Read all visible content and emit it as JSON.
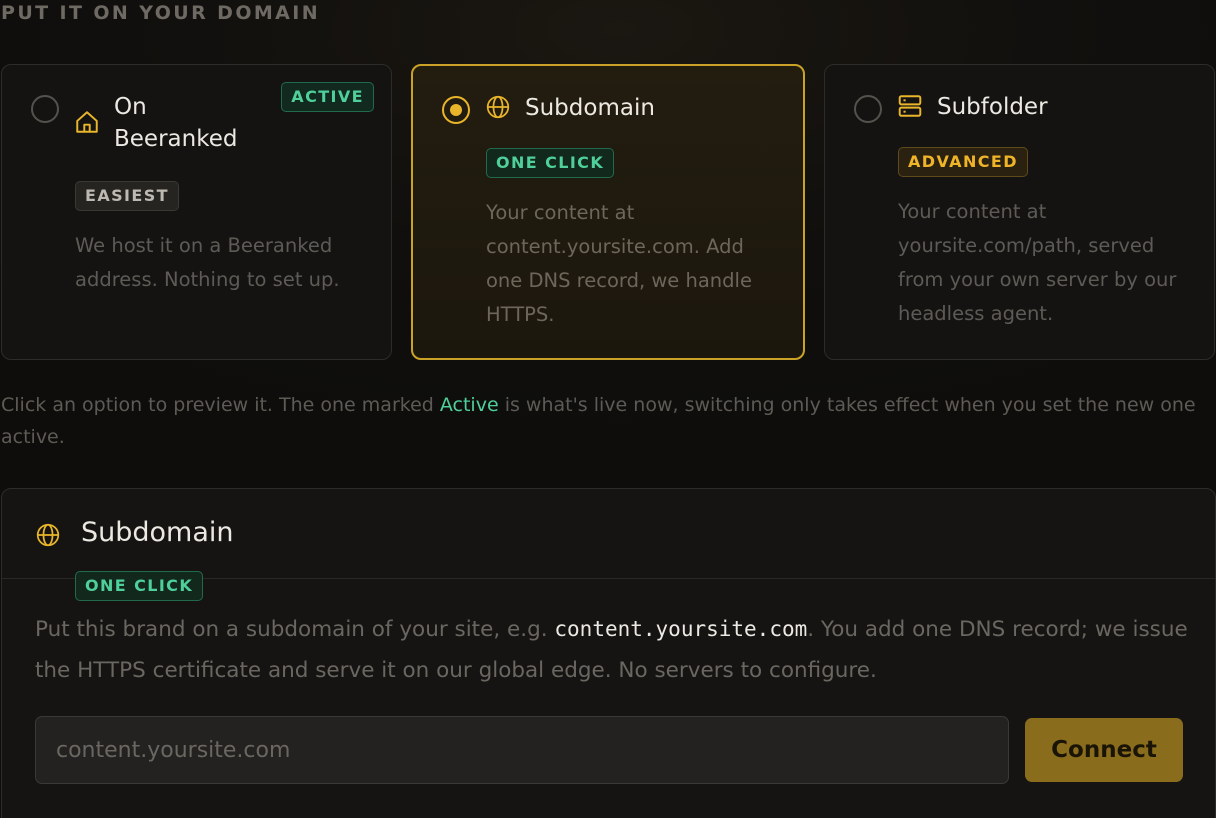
{
  "section_title": "PUT IT ON YOUR DOMAIN",
  "options": [
    {
      "title": "On Beeranked",
      "icon": "home-icon",
      "badge": "EASIEST",
      "status_badge": "ACTIVE",
      "description": "We host it on a Beeranked address. Nothing to set up.",
      "selected": false
    },
    {
      "title": "Subdomain",
      "icon": "globe-icon",
      "badge": "ONE CLICK",
      "description": "Your content at content.yoursite.com. Add one DNS record, we handle HTTPS.",
      "selected": true
    },
    {
      "title": "Subfolder",
      "icon": "server-icon",
      "badge": "ADVANCED",
      "description": "Your content at yoursite.com/path, served from your own server by our headless agent.",
      "selected": false
    }
  ],
  "hint": {
    "before": "Click an option to preview it. The one marked ",
    "highlight": "Active",
    "after": " is what's live now, switching only takes effect when you set the new one active."
  },
  "panel": {
    "title": "Subdomain",
    "badge": "ONE CLICK",
    "desc_before": "Put this brand on a subdomain of your site, e.g. ",
    "desc_code": "content.yoursite.com",
    "desc_after": ". You add one DNS record; we issue the HTTPS certificate and serve it on our global edge. No servers to configure.",
    "input_placeholder": "content.yoursite.com",
    "input_value": "",
    "button_label": "Connect"
  },
  "colors": {
    "accent": "#e9b52a",
    "success": "#4fcf9a",
    "button": "#8a6d1c"
  }
}
